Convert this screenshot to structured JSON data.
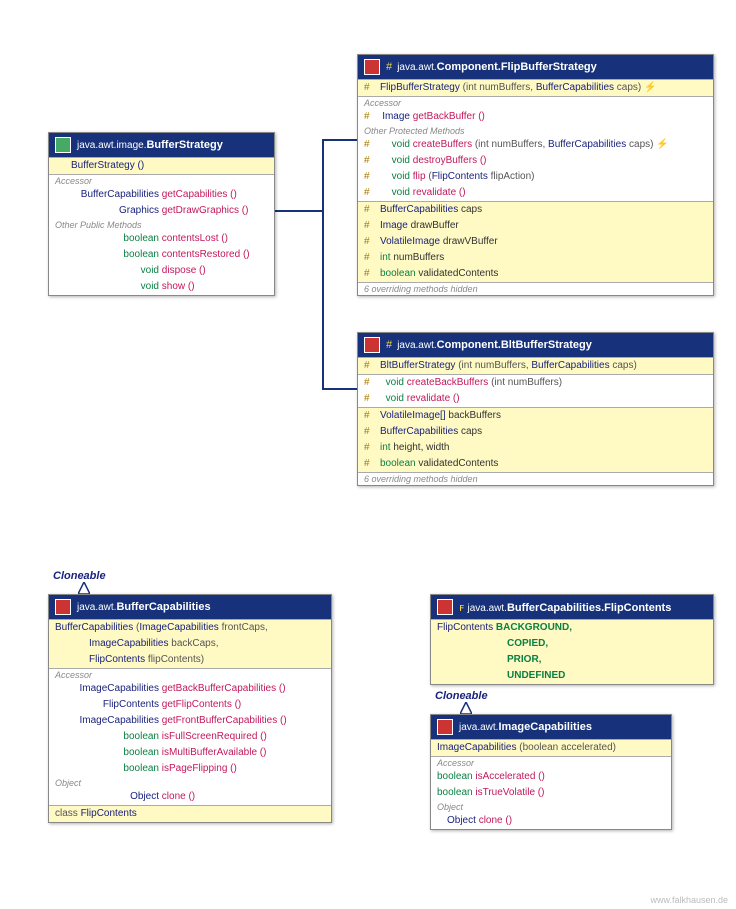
{
  "footer": "www.falkhausen.de",
  "cloneable": "Cloneable",
  "bs": {
    "pkg": "java.awt.image.",
    "name": "BufferStrategy",
    "ctor": "BufferStrategy ()",
    "accessor": "Accessor",
    "r1t": "BufferCapabilities",
    "r1n": "getCapabilities ()",
    "r2t": "Graphics",
    "r2n": "getDrawGraphics ()",
    "opm": "Other Public Methods",
    "r3t": "boolean",
    "r3n": "contentsLost ()",
    "r4t": "boolean",
    "r4n": "contentsRestored ()",
    "r5t": "void",
    "r5n": "dispose ()",
    "r6t": "void",
    "r6n": "show ()"
  },
  "fbs": {
    "pkg": "java.awt.",
    "name": "Component.FlipBufferStrategy",
    "ctort": "FlipBufferStrategy",
    "ctorp": " (int numBuffers, ",
    "ctorp2": " caps) ",
    "bc": "BufferCapabilities",
    "thr": "⚡",
    "accessor": "Accessor",
    "r1t": "Image",
    "r1n": "getBackBuffer ()",
    "opm": "Other Protected Methods",
    "r2t": "void",
    "r2n": "createBuffers",
    "r2p": " (int numBuffers, ",
    "r2p2": " caps) ",
    "r3t": "void",
    "r3n": "destroyBuffers ()",
    "r4t": "void",
    "r4n": "flip",
    "r4p": " (",
    "r4p2": " flipAction)",
    "fc": "FlipContents",
    "r5t": "void",
    "r5n": "revalidate ()",
    "f1t": "BufferCapabilities",
    "f1n": "caps",
    "f2t": "Image",
    "f2n": "drawBuffer",
    "f3t": "VolatileImage",
    "f3n": "drawVBuffer",
    "f4t": "int",
    "f4n": "numBuffers",
    "f5t": "boolean",
    "f5n": "validatedContents",
    "over": "6 overriding methods hidden"
  },
  "bbs": {
    "pkg": "java.awt.",
    "name": "Component.BltBufferStrategy",
    "ctort": "BltBufferStrategy",
    "ctorp": " (int numBuffers, ",
    "bc": "BufferCapabilities",
    "ctorp2": " caps)",
    "r1t": "void",
    "r1n": "createBackBuffers",
    "r1p": " (int numBuffers)",
    "r2t": "void",
    "r2n": "revalidate ()",
    "f1t": "VolatileImage[]",
    "f1n": "backBuffers",
    "f2t": "BufferCapabilities",
    "f2n": "caps",
    "f3t": "int",
    "f3n": "height, width",
    "f4t": "boolean",
    "f4n": "validatedContents",
    "over": "6 overriding methods hidden"
  },
  "bc": {
    "pkg": "java.awt.",
    "name": "BufferCapabilities",
    "c1": "BufferCapabilities",
    "c1p": " (",
    "ic": "ImageCapabilities",
    "c1p2": " frontCaps,",
    "c2p": " backCaps,",
    "c3t": "FlipContents",
    "c3p": " flipContents)",
    "accessor": "Accessor",
    "r1t": "ImageCapabilities",
    "r1n": "getBackBufferCapabilities ()",
    "r2t": "FlipContents",
    "r2n": "getFlipContents ()",
    "r3t": "ImageCapabilities",
    "r3n": "getFrontBufferCapabilities ()",
    "r4t": "boolean",
    "r4n": "isFullScreenRequired ()",
    "r5t": "boolean",
    "r5n": "isMultiBufferAvailable ()",
    "r6t": "boolean",
    "r6n": "isPageFlipping ()",
    "obj": "Object",
    "r7t": "Object",
    "r7n": "clone ()",
    "inner": "class",
    "innerN": "FlipContents"
  },
  "fc": {
    "pkg": "java.awt.",
    "name": "BufferCapabilities.FlipContents",
    "t": "FlipContents",
    "v1": "BACKGROUND,",
    "v2": "COPIED,",
    "v3": "PRIOR,",
    "v4": "UNDEFINED"
  },
  "ic": {
    "pkg": "java.awt.",
    "name": "ImageCapabilities",
    "c1": "ImageCapabilities",
    "c1p": " (boolean accelerated)",
    "accessor": "Accessor",
    "r1t": "boolean",
    "r1n": "isAccelerated ()",
    "r2t": "boolean",
    "r2n": "isTrueVolatile ()",
    "obj": "Object",
    "r3t": "Object",
    "r3n": "clone ()"
  }
}
